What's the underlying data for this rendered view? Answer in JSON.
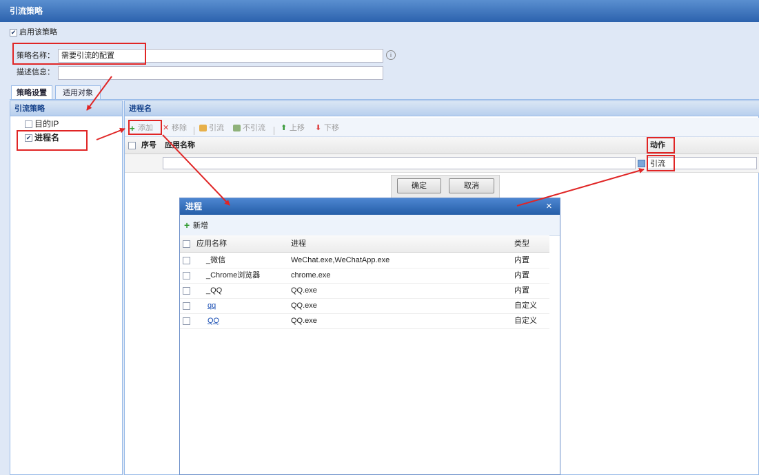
{
  "window": {
    "title": "引流策略"
  },
  "enable": {
    "checked_mark": "✔",
    "label": "启用该策略"
  },
  "form": {
    "name_label": "策略名称：",
    "name_value": "需要引流的配置",
    "info_icon": "info-icon",
    "desc_label": "描述信息："
  },
  "tabs": [
    "策略设置",
    "适用对象"
  ],
  "left_panel": {
    "header": "引流策略",
    "items": [
      {
        "label": "目的IP",
        "checked": false
      },
      {
        "label": "进程名",
        "checked": true,
        "mark": "✔"
      }
    ]
  },
  "right_panel": {
    "header": "进程名",
    "toolbar": {
      "add": {
        "icon": "+",
        "label": "添加"
      },
      "remove": {
        "icon": "✕",
        "label": "移除"
      },
      "redirect": {
        "label": "引流"
      },
      "no_redirect": {
        "label": "不引流"
      },
      "up": {
        "icon": "⬆",
        "label": "上移"
      },
      "down": {
        "icon": "⬇",
        "label": "下移"
      }
    },
    "grid": {
      "col_index": "序号",
      "col_app": "应用名称",
      "col_action": "动作",
      "row_action": "引流"
    },
    "ok_button": "确定",
    "cancel_button": "取消"
  },
  "dialog": {
    "title": "进程",
    "close": "×",
    "new_button": {
      "icon": "+",
      "label": "新增"
    },
    "columns": [
      "应用名称",
      "进程",
      "类型"
    ],
    "rows": [
      {
        "app": "_微信",
        "process": "WeChat.exe,WeChatApp.exe",
        "type": "内置",
        "link": false
      },
      {
        "app": "_Chrome浏览器",
        "process": "chrome.exe",
        "type": "内置",
        "link": false
      },
      {
        "app": "_QQ",
        "process": "QQ.exe",
        "type": "内置",
        "link": false
      },
      {
        "app": "qq",
        "process": "QQ.exe",
        "type": "自定义",
        "link": true
      },
      {
        "app": "QQ",
        "process": "QQ.exe",
        "type": "自定义",
        "link": true
      }
    ]
  },
  "colors": {
    "title_bar": "#2c62ad",
    "panel_bg": "#dfe8f6",
    "annotation": "#e02525",
    "add_icon": "#2e9a2e"
  }
}
